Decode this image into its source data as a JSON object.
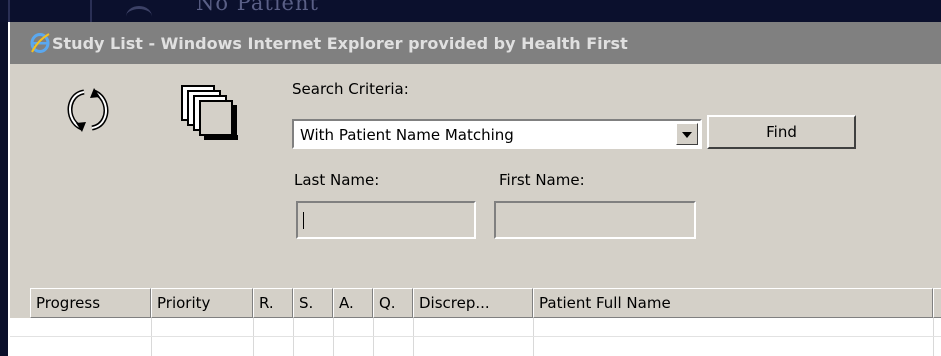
{
  "background": {
    "partial_text": "No Patient"
  },
  "window": {
    "title": "Study List - Windows Internet Explorer provided by Health First",
    "icon": "internet-explorer-icon"
  },
  "toolbar": {
    "refresh_icon": "refresh-icon",
    "open_icon": "stacked-documents-icon",
    "search_criteria_label": "Search Criteria:",
    "search_criteria_value": "With Patient Name Matching",
    "find_label": "Find",
    "last_name_label": "Last Name:",
    "first_name_label": "First Name:",
    "last_name_value": "",
    "first_name_value": ""
  },
  "grid": {
    "columns": [
      "Progress",
      "Priority",
      "R.",
      "S.",
      "A.",
      "Q.",
      "Discrep...",
      "Patient Full Name"
    ]
  }
}
